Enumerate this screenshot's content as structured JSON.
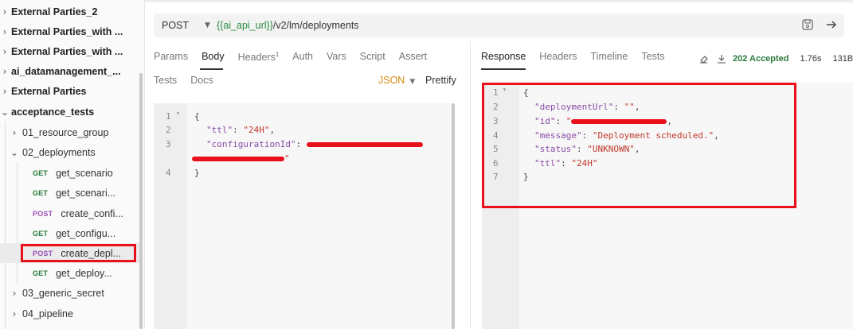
{
  "sidebar": {
    "folders": [
      {
        "label": "External Parties_2",
        "chevron": "right"
      },
      {
        "label": "External Parties_with ...",
        "chevron": "right"
      },
      {
        "label": "External Parties_with ...",
        "chevron": "right"
      },
      {
        "label": "ai_datamanagement_...",
        "chevron": "right"
      },
      {
        "label": "External Parties",
        "chevron": "right"
      },
      {
        "label": "acceptance_tests",
        "chevron": "down"
      }
    ],
    "subfolders": [
      {
        "label": "01_resource_group",
        "chevron": "right"
      },
      {
        "label": "02_deployments",
        "chevron": "down"
      },
      {
        "label": "03_generic_secret",
        "chevron": "right"
      },
      {
        "label": "04_pipeline",
        "chevron": "right"
      }
    ],
    "requests": [
      {
        "method": "GET",
        "label": "get_scenario"
      },
      {
        "method": "GET",
        "label": "get_scenari..."
      },
      {
        "method": "POST",
        "label": "create_confi..."
      },
      {
        "method": "GET",
        "label": "get_configu..."
      },
      {
        "method": "POST",
        "label": "create_depl..."
      },
      {
        "method": "GET",
        "label": "get_deploy..."
      }
    ]
  },
  "url_bar": {
    "method": "POST",
    "variable": "{{ai_api_url}}",
    "path": "/v2/lm/deployments"
  },
  "request_tabs": {
    "params": "Params",
    "body": "Body",
    "headers": "Headers",
    "headers_count": "1",
    "auth": "Auth",
    "vars": "Vars",
    "script": "Script",
    "assert": "Assert",
    "tests": "Tests",
    "docs": "Docs",
    "body_mode": "JSON",
    "prettify": "Prettify"
  },
  "request_body": {
    "line_numbers": [
      "1",
      "2",
      "3",
      "4"
    ],
    "brace_open": "{",
    "brace_close": "}",
    "ttl_key": "\"ttl\"",
    "ttl_value": "\"24H\"",
    "config_key": "\"configurationId\"",
    "config_value_end": "\""
  },
  "response_tabs": {
    "response": "Response",
    "headers": "Headers",
    "timeline": "Timeline",
    "tests": "Tests"
  },
  "response_status": {
    "status": "202 Accepted",
    "time": "1.76s",
    "size": "131B"
  },
  "response_body": {
    "line_numbers": [
      "1",
      "2",
      "3",
      "4",
      "5",
      "6",
      "7"
    ],
    "brace_open": "{",
    "brace_close": "}",
    "deployment_url_key": "\"deploymentUrl\"",
    "deployment_url_value": "\"\"",
    "id_key": "\"id\"",
    "id_value_start": "\"",
    "message_key": "\"message\"",
    "message_value": "\"Deployment scheduled.\"",
    "status_key": "\"status\"",
    "status_value": "\"UNKNOWN\"",
    "ttl_key": "\"ttl\"",
    "ttl_value": "\"24H\""
  },
  "colors": {
    "accent_red": "#e8101a",
    "status_green": "#2a7a3b",
    "json_orange": "#d6880b",
    "post_purple": "#9b4fb8",
    "get_green": "#217a38"
  },
  "icons": [
    "chevron-right-icon",
    "chevron-down-icon",
    "save-icon",
    "send-arrow-icon",
    "eraser-icon",
    "download-icon",
    "fold-arrow-icon"
  ]
}
